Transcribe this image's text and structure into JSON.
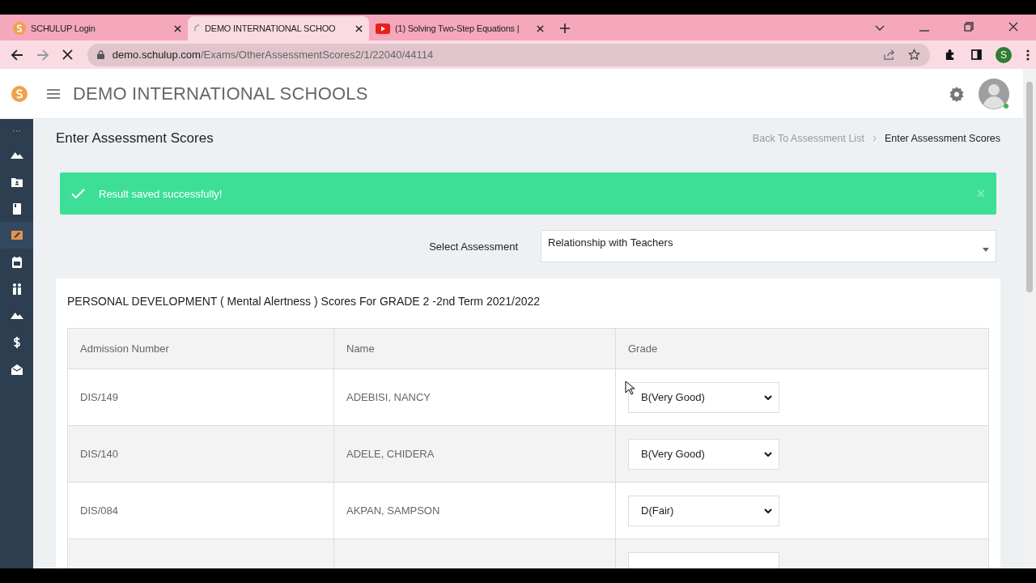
{
  "browser": {
    "tabs": [
      {
        "title": "SCHULUP Login",
        "kind": "site",
        "selected": false
      },
      {
        "title": "DEMO INTERNATIONAL SCHOO",
        "kind": "loading",
        "selected": true
      },
      {
        "title": "(1) Solving Two-Step Equations |",
        "kind": "video",
        "selected": false
      }
    ],
    "url_host": "demo.schulup.com",
    "url_path": "/Exams/OtherAssessmentScores2/1/22040/44114",
    "profile_initial": "S"
  },
  "header": {
    "school_name": "DEMO INTERNATIONAL SCHOOLS"
  },
  "sidebar": {
    "toggle": "···",
    "items": [
      {
        "selected": false
      },
      {
        "selected": false
      },
      {
        "selected": false
      },
      {
        "selected": true
      },
      {
        "selected": false
      },
      {
        "selected": false
      },
      {
        "selected": false
      },
      {
        "selected": false
      },
      {
        "selected": false
      }
    ]
  },
  "page_title": "Enter Assessment Scores",
  "breadcrumb": [
    {
      "label": "Back To Assessment List",
      "current": false
    },
    {
      "label": "Enter Assessment Scores",
      "current": true
    }
  ],
  "alert": {
    "message": "Result saved successfully!"
  },
  "assessment": {
    "label": "Select Assessment",
    "value": "Relationship with Teachers"
  },
  "card": {
    "title": "PERSONAL DEVELOPMENT ( Mental Alertness ) Scores For GRADE 2 -2nd Term 2021/2022"
  },
  "table": {
    "columns": [
      "Admission Number",
      "Name",
      "Grade"
    ],
    "rows": [
      {
        "admission_number": "DIS/149",
        "name": "ADEBISI, NANCY",
        "grade": "B(Very Good)"
      },
      {
        "admission_number": "DIS/140",
        "name": "ADELE, CHIDERA",
        "grade": "B(Very Good)"
      },
      {
        "admission_number": "DIS/084",
        "name": "AKPAN, SAMPSON",
        "grade": "D(Fair)"
      },
      {}
    ]
  }
}
